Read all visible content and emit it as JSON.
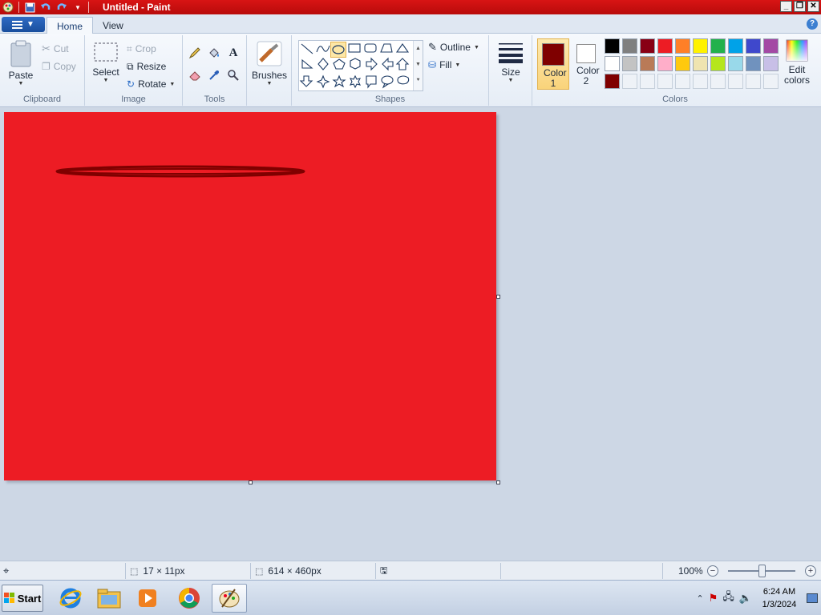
{
  "window": {
    "title": "Untitled - Paint"
  },
  "ribbon": {
    "tabs": [
      "Home",
      "View"
    ],
    "clipboard": {
      "paste": "Paste",
      "cut": "Cut",
      "copy": "Copy",
      "label": "Clipboard"
    },
    "image": {
      "select": "Select",
      "crop": "Crop",
      "resize": "Resize",
      "rotate": "Rotate",
      "label": "Image"
    },
    "tools": {
      "label": "Tools"
    },
    "brushes": {
      "label": "Brushes"
    },
    "shapes": {
      "outline": "Outline",
      "fill": "Fill",
      "label": "Shapes"
    },
    "size": {
      "label": "Size"
    },
    "colors": {
      "color1": "Color 1",
      "color2": "Color 2",
      "edit": "Edit colors",
      "label": "Colors",
      "color1_value": "#7f0000",
      "color2_value": "#ffffff",
      "palette_row1": [
        "#000000",
        "#7f7f7f",
        "#880015",
        "#ed1c24",
        "#ff7f27",
        "#fff200",
        "#22b14c",
        "#00a2e8",
        "#3f48cc",
        "#a349a4"
      ],
      "palette_row2": [
        "#ffffff",
        "#c3c3c3",
        "#b97a57",
        "#ffaec9",
        "#ffc90e",
        "#efe4b0",
        "#b5e61d",
        "#99d9ea",
        "#7092be",
        "#c8bfe7"
      ],
      "palette_row3": [
        "#7f0000",
        "",
        "",
        "",
        "",
        "",
        "",
        "",
        "",
        ""
      ]
    }
  },
  "canvas": {
    "background": "#ed1c24",
    "stroke_color": "#7f0000"
  },
  "status": {
    "selection_size": "17 × 11px",
    "canvas_size": "614 × 460px",
    "zoom": "100%"
  },
  "taskbar": {
    "start": "Start",
    "apps": [
      "internet-explorer",
      "file-explorer",
      "media-player",
      "chrome",
      "paint"
    ],
    "time": "6:24 AM",
    "date": "1/3/2024"
  }
}
